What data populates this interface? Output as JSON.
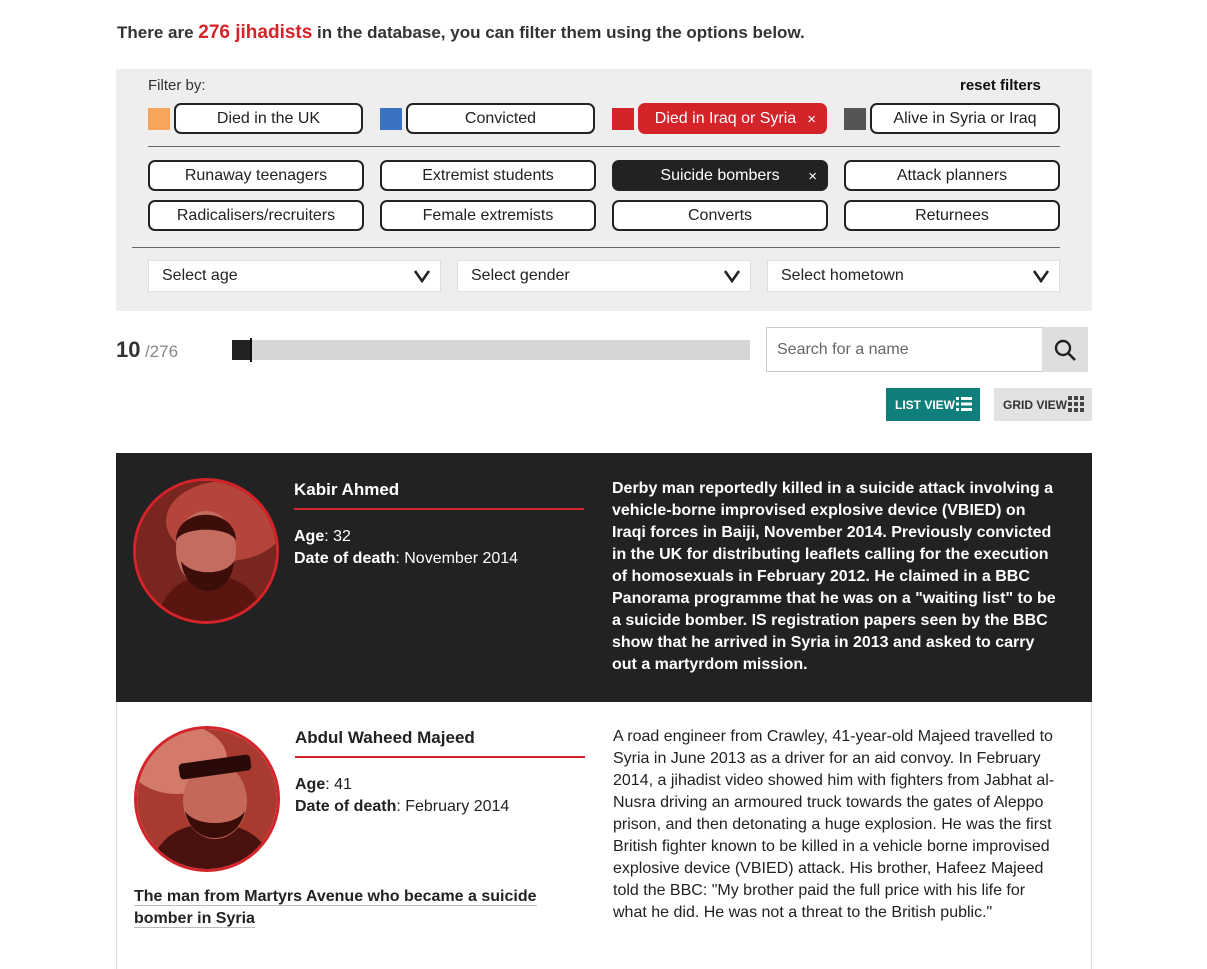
{
  "intro": {
    "prefix": "There are ",
    "count": "276 jihadists",
    "suffix": " in the database, you can filter them using the options below."
  },
  "filters": {
    "label": "Filter by:",
    "reset": "reset filters",
    "status": [
      {
        "label": "Died in the UK",
        "color": "#f7a55a",
        "active": false
      },
      {
        "label": "Convicted",
        "color": "#3a74c1",
        "active": false
      },
      {
        "label": "Died in Iraq or Syria",
        "color": "#d5232a",
        "active": true
      },
      {
        "label": "Alive in Syria or Iraq",
        "color": "#555555",
        "active": false
      }
    ],
    "categories": [
      {
        "label": "Runaway teenagers",
        "active": false
      },
      {
        "label": "Extremist students",
        "active": false
      },
      {
        "label": "Suicide bombers",
        "active": true
      },
      {
        "label": "Attack planners",
        "active": false
      },
      {
        "label": "Radicalisers/recruiters",
        "active": false
      },
      {
        "label": "Female extremists",
        "active": false
      },
      {
        "label": "Converts",
        "active": false
      },
      {
        "label": "Returnees",
        "active": false
      }
    ],
    "close_glyph": "×",
    "selects": {
      "age": "Select age",
      "gender": "Select gender",
      "hometown": "Select hometown"
    }
  },
  "results": {
    "shown": "10",
    "total": "/276",
    "fraction": 0.036
  },
  "search": {
    "placeholder": "Search for a name",
    "value": ""
  },
  "views": {
    "list": "LIST VIEW",
    "grid": "GRID VIEW",
    "active": "list"
  },
  "people": [
    {
      "name": "Kabir Ahmed",
      "age_label": "Age",
      "age": ": 32",
      "death_label": "Date of death",
      "death": ": November 2014",
      "bio": "Derby man reportedly killed in a suicide attack involving a vehicle-borne improvised explosive device (VBIED) on Iraqi forces in Baiji, November 2014. Previously convicted in the UK for distributing leaflets calling for the execution of homosexuals in February 2012. He claimed in a BBC Panorama programme that he was on a \"waiting list\" to be a suicide bomber. IS registration papers seen by the BBC show that he arrived in Syria in 2013 and asked to carry out a martyrdom mission.",
      "story": ""
    },
    {
      "name": "Abdul Waheed Majeed",
      "age_label": "Age",
      "age": ": 41",
      "death_label": "Date of death",
      "death": ": February 2014",
      "bio": "A road engineer from Crawley, 41-year-old Majeed travelled to Syria in June 2013 as a driver for an aid convoy. In February 2014, a jihadist video showed him with fighters from Jabhat al-Nusra driving an armoured truck towards the gates of Aleppo prison, and then detonating a huge explosion. He was the first British fighter known to be killed in a vehicle borne improvised explosive device (VBIED) attack. His brother, Hafeez Majeed told the BBC: \"My brother paid the full price with his life for what he did. He was not a threat to the British public.\"",
      "story": "The man from Martyrs Avenue who became a suicide bomber in Syria"
    }
  ]
}
